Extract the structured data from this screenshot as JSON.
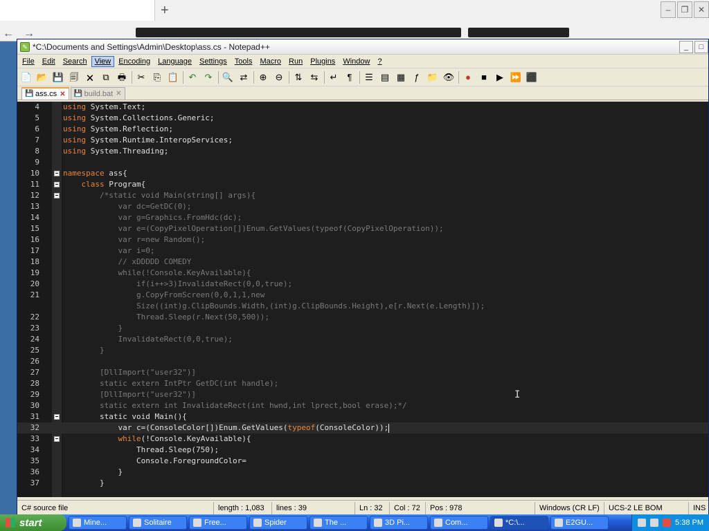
{
  "window": {
    "title": "*C:\\Documents and Settings\\Admin\\Desktop\\ass.cs - Notepad++"
  },
  "menu": [
    "File",
    "Edit",
    "Search",
    "View",
    "Encoding",
    "Language",
    "Settings",
    "Tools",
    "Macro",
    "Run",
    "Plugins",
    "Window",
    "?"
  ],
  "tabs": [
    {
      "label": "ass.cs",
      "active": true
    },
    {
      "label": "build.bat",
      "active": false
    }
  ],
  "code_lines": [
    {
      "n": "4",
      "fold": false,
      "text": "using System.Text;"
    },
    {
      "n": "5",
      "fold": false,
      "text": "using System.Collections.Generic;"
    },
    {
      "n": "6",
      "fold": false,
      "text": "using System.Reflection;"
    },
    {
      "n": "7",
      "fold": false,
      "text": "using System.Runtime.InteropServices;"
    },
    {
      "n": "8",
      "fold": false,
      "text": "using System.Threading;"
    },
    {
      "n": "9",
      "fold": false,
      "text": ""
    },
    {
      "n": "10",
      "fold": true,
      "text": "namespace ass{"
    },
    {
      "n": "11",
      "fold": true,
      "text": "    class Program{"
    },
    {
      "n": "12",
      "fold": true,
      "text": "        /*static void Main(string[] args){"
    },
    {
      "n": "13",
      "fold": false,
      "text": "            var dc=GetDC(0);"
    },
    {
      "n": "14",
      "fold": false,
      "text": "            var g=Graphics.FromHdc(dc);"
    },
    {
      "n": "15",
      "fold": false,
      "text": "            var e=(CopyPixelOperation[])Enum.GetValues(typeof(CopyPixelOperation));"
    },
    {
      "n": "16",
      "fold": false,
      "text": "            var r=new Random();"
    },
    {
      "n": "17",
      "fold": false,
      "text": "            var i=0;"
    },
    {
      "n": "18",
      "fold": false,
      "text": "            // xDDDDD COMEDY"
    },
    {
      "n": "19",
      "fold": false,
      "text": "            while(!Console.KeyAvailable){"
    },
    {
      "n": "20",
      "fold": false,
      "text": "                if(i++>3)InvalidateRect(0,0,true);"
    },
    {
      "n": "21",
      "fold": false,
      "text": "                g.CopyFromScreen(0,0,1,1,new"
    },
    {
      "n": "",
      "fold": false,
      "text": "                Size((int)g.ClipBounds.Width,(int)g.ClipBounds.Height),e[r.Next(e.Length)]);"
    },
    {
      "n": "22",
      "fold": false,
      "text": "                Thread.Sleep(r.Next(50,500));"
    },
    {
      "n": "23",
      "fold": false,
      "text": "            }"
    },
    {
      "n": "24",
      "fold": false,
      "text": "            InvalidateRect(0,0,true);"
    },
    {
      "n": "25",
      "fold": false,
      "text": "        }"
    },
    {
      "n": "26",
      "fold": false,
      "text": ""
    },
    {
      "n": "27",
      "fold": false,
      "text": "        [DllImport(\"user32\")]"
    },
    {
      "n": "28",
      "fold": false,
      "text": "        static extern IntPtr GetDC(int handle);"
    },
    {
      "n": "29",
      "fold": false,
      "text": "        [DllImport(\"user32\")]"
    },
    {
      "n": "30",
      "fold": false,
      "text": "        static extern int InvalidateRect(int hwnd,int lprect,bool erase);*/"
    },
    {
      "n": "31",
      "fold": true,
      "text": "        static void Main(){"
    },
    {
      "n": "32",
      "fold": false,
      "text": "            var c=(ConsoleColor[])Enum.GetValues(typeof(ConsoleColor));",
      "current": true
    },
    {
      "n": "33",
      "fold": true,
      "text": "            while(!Console.KeyAvailable){"
    },
    {
      "n": "34",
      "fold": false,
      "text": "                Thread.Sleep(750);"
    },
    {
      "n": "35",
      "fold": false,
      "text": "                Console.ForegroundColor="
    },
    {
      "n": "36",
      "fold": false,
      "text": "            }"
    },
    {
      "n": "37",
      "fold": false,
      "text": "        }"
    }
  ],
  "status": {
    "filetype": "C# source file",
    "length": "length : 1,083",
    "lines": "lines : 39",
    "ln": "Ln : 32",
    "col": "Col : 72",
    "pos": "Pos : 978",
    "eol": "Windows (CR LF)",
    "encoding": "UCS-2 LE BOM",
    "mode": "INS"
  },
  "taskbar": {
    "start": "start",
    "tasks": [
      "Mine...",
      "Solitaire",
      "Free...",
      "Spider",
      "The ...",
      "3D Pi...",
      "Com...",
      "*C:\\...",
      "E2GU..."
    ],
    "active_task": 7,
    "clock": "5:38 PM"
  }
}
